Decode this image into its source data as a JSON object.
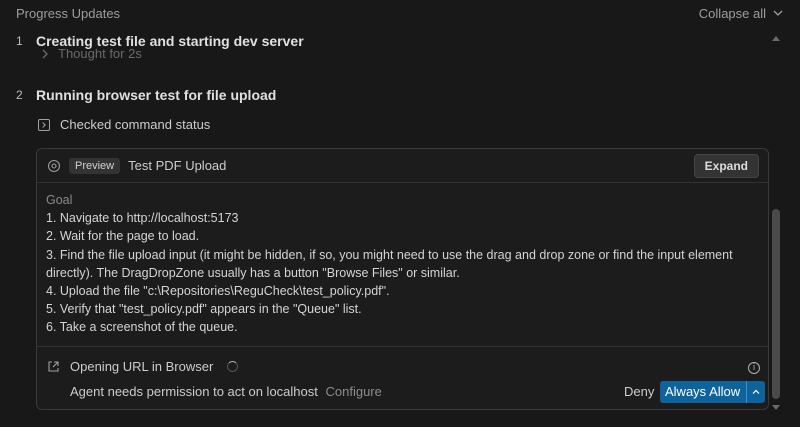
{
  "header": {
    "title": "Progress Updates",
    "collapse_label": "Collapse all"
  },
  "steps": [
    {
      "number": "1",
      "title": "Creating test file and starting dev server",
      "thought": "Thought for 2s"
    },
    {
      "number": "2",
      "title": "Running browser test for file upload"
    }
  ],
  "checked_status": "Checked command status",
  "card": {
    "badge": "Preview",
    "title": "Test PDF Upload",
    "expand_label": "Expand",
    "goal_label": "Goal",
    "goal_lines": [
      "1. Navigate to http://localhost:5173",
      "2. Wait for the page to load.",
      "3. Find the file upload input (it might be hidden, if so, you might need to use the drag and drop zone or find the input element",
      "directly). The DragDropZone usually has a button \"Browse Files\" or similar.",
      "4. Upload the file \"c:\\Repositories\\ReguCheck\\test_policy.pdf\".",
      "5. Verify that \"test_policy.pdf\" appears in the \"Queue\" list.",
      "6. Take a screenshot of the queue."
    ],
    "opening_label": "Opening URL in Browser",
    "permission_text": "Agent needs permission to act on localhost",
    "configure_label": "Configure",
    "deny_label": "Deny",
    "allow_label": "Always Allow"
  },
  "colors": {
    "background": "#181818",
    "accent": "#0e639c",
    "text": "#cccccc"
  }
}
